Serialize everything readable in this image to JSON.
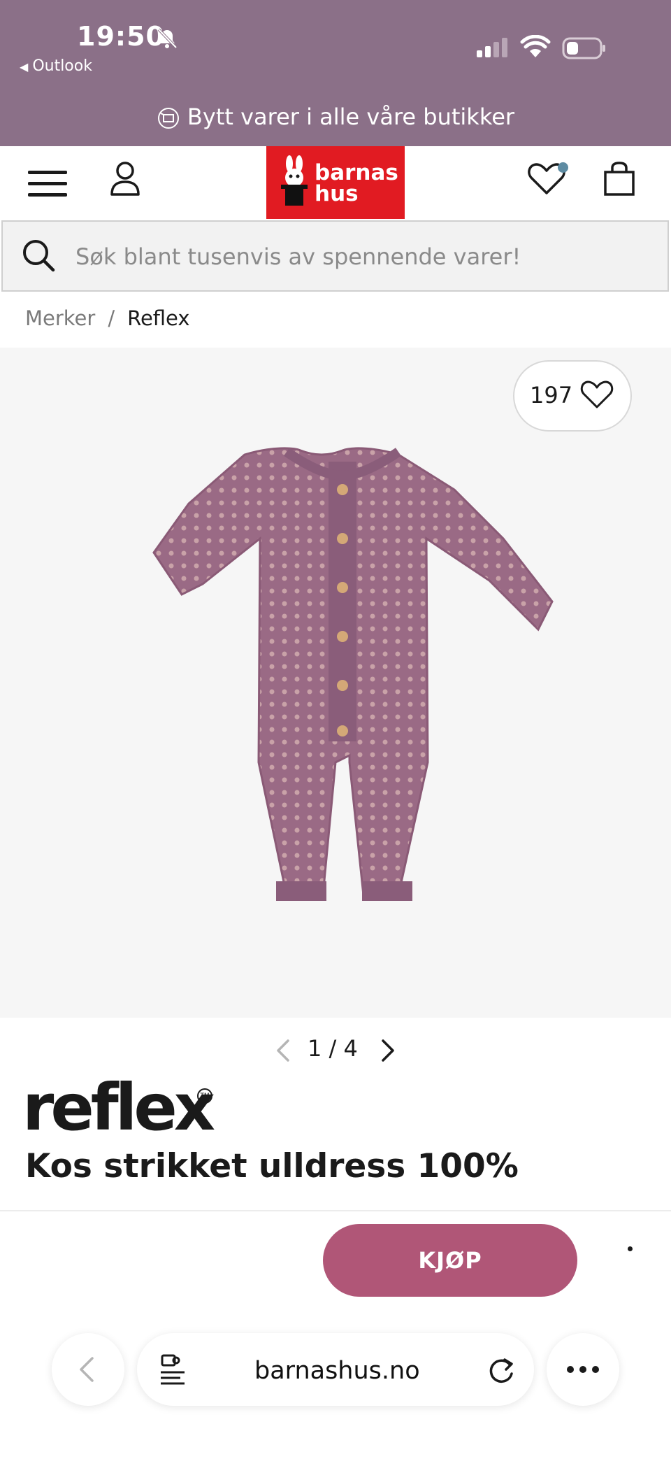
{
  "status_bar": {
    "time": "19:50",
    "back_app": "Outlook"
  },
  "promo": {
    "text": "Bytt varer i alle våre butikker"
  },
  "header": {
    "logo_line1": "barnas",
    "logo_line2": "hus"
  },
  "search": {
    "placeholder": "Søk blant tusenvis av spennende varer!"
  },
  "breadcrumb": {
    "items": [
      "Merker",
      "Reflex"
    ],
    "separator": "/"
  },
  "product": {
    "like_count": "197",
    "image_pager": "1 / 4",
    "brand": "reflex",
    "brand_mark": "TM",
    "title": "Kos strikket ulldress 100%"
  },
  "buy": {
    "label": "KJØP"
  },
  "browser": {
    "domain": "barnashus.no"
  },
  "colors": {
    "status_bg": "#8b7088",
    "logo_red": "#e11b22",
    "buy": "#b05677",
    "product": "#9a6a85"
  },
  "icons": [
    "bell-off-icon",
    "signal-icon",
    "wifi-icon",
    "battery-icon",
    "exchange-icon",
    "menu-icon",
    "user-icon",
    "heart-icon",
    "bag-icon",
    "search-icon",
    "chevron-left-icon",
    "chevron-right-icon",
    "puzzle-icon",
    "reload-icon",
    "more-icon"
  ]
}
